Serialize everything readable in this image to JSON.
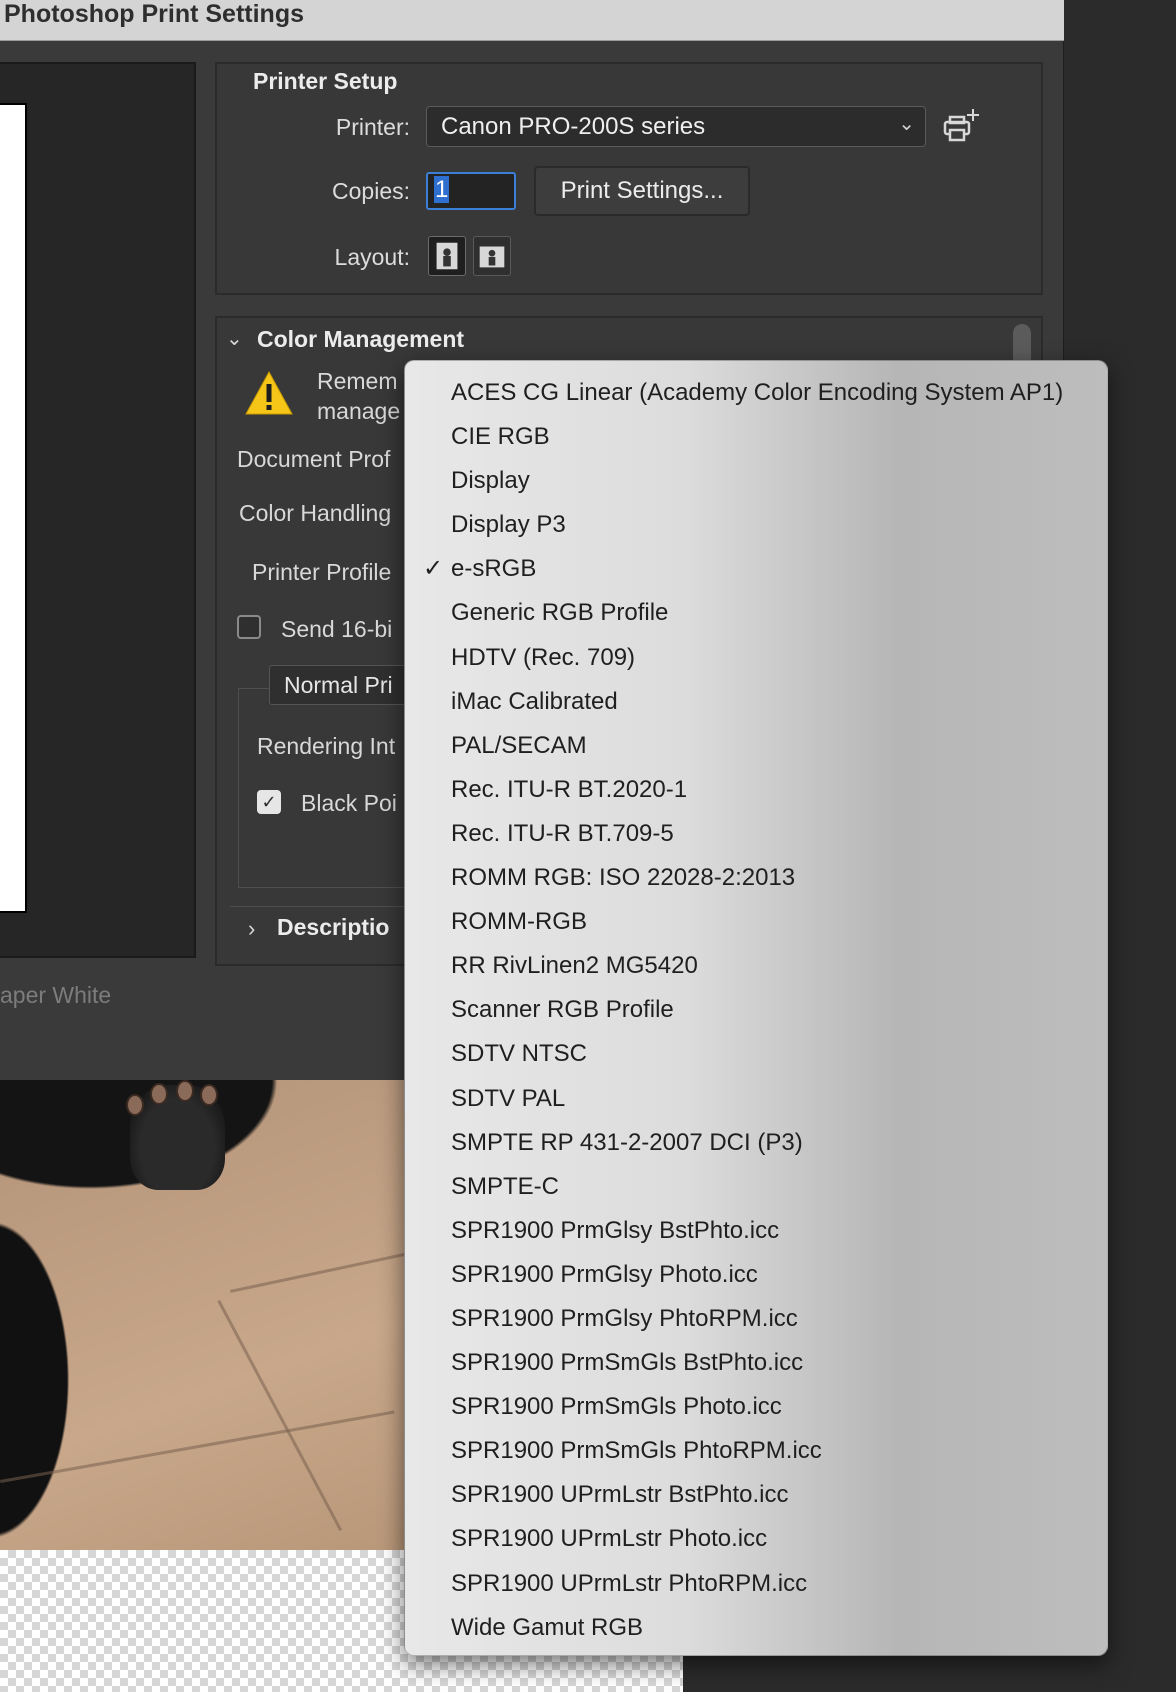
{
  "window": {
    "title": "Photoshop Print Settings"
  },
  "preview": {
    "paper_white_label": "aper White"
  },
  "printer_setup": {
    "title": "Printer Setup",
    "printer_label": "Printer:",
    "printer_value": "Canon PRO-200S series",
    "copies_label": "Copies:",
    "copies_value": "1",
    "print_settings_button": "Print Settings...",
    "layout_label": "Layout:"
  },
  "color_management": {
    "title": "Color Management",
    "warning_line1": "Remem",
    "warning_line2": "manage",
    "document_profile_label": "Document Prof",
    "color_handling_label": "Color Handling",
    "printer_profile_label": "Printer Profile",
    "send_16bit_label": "Send 16-bi",
    "send_16bit_checked": false,
    "normal_print_value": "Normal Pri",
    "rendering_intent_label": "Rendering Int",
    "black_point_label": "Black Poi",
    "black_point_checked": true,
    "description_label": "Descriptio"
  },
  "profile_menu": {
    "selected": "e-sRGB",
    "items": [
      "ACES CG Linear (Academy Color Encoding System AP1)",
      "CIE RGB",
      "Display",
      "Display P3",
      "e-sRGB",
      "Generic RGB Profile",
      "HDTV (Rec. 709)",
      "iMac Calibrated",
      "PAL/SECAM",
      "Rec. ITU-R BT.2020-1",
      "Rec. ITU-R BT.709-5",
      "ROMM RGB: ISO 22028-2:2013",
      "ROMM-RGB",
      "RR RivLinen2 MG5420",
      "Scanner RGB Profile",
      "SDTV NTSC",
      "SDTV PAL",
      "SMPTE RP 431-2-2007 DCI (P3)",
      "SMPTE-C",
      "SPR1900 PrmGlsy BstPhto.icc",
      "SPR1900 PrmGlsy Photo.icc",
      "SPR1900 PrmGlsy PhtoRPM.icc",
      "SPR1900 PrmSmGls BstPhto.icc",
      "SPR1900 PrmSmGls Photo.icc",
      "SPR1900 PrmSmGls PhtoRPM.icc",
      "SPR1900 UPrmLstr BstPhto.icc",
      "SPR1900 UPrmLstr Photo.icc",
      "SPR1900 UPrmLstr PhtoRPM.icc",
      "Wide Gamut RGB"
    ]
  },
  "colors": {
    "dialog_bg": "#3a3a3a",
    "titlebar_bg": "#d4d4d4",
    "focus_blue": "#3b7fd6",
    "warning_yellow": "#f5c518",
    "menu_bg": "#e0e0e0"
  }
}
